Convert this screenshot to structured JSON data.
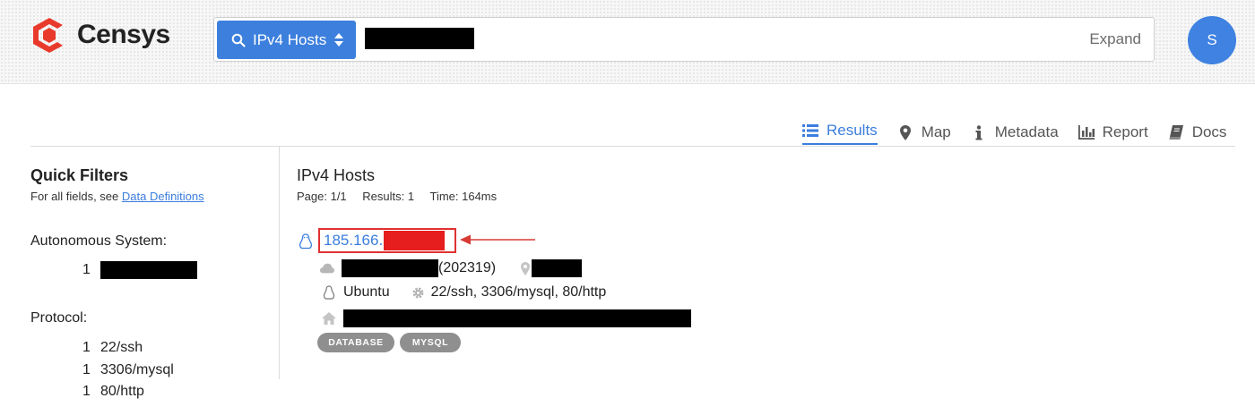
{
  "brand": {
    "name": "Censys"
  },
  "search": {
    "type_label": "IPv4 Hosts",
    "query_value": "",
    "expand_label": "Expand"
  },
  "user": {
    "avatar_initial": "S"
  },
  "tabs": [
    {
      "label": "Results",
      "icon": "list-icon",
      "active": true
    },
    {
      "label": "Map",
      "icon": "map-pin-icon",
      "active": false
    },
    {
      "label": "Metadata",
      "icon": "info-icon",
      "active": false
    },
    {
      "label": "Report",
      "icon": "bar-chart-icon",
      "active": false
    },
    {
      "label": "Docs",
      "icon": "book-icon",
      "active": false
    }
  ],
  "sidebar": {
    "title": "Quick Filters",
    "subtitle_prefix": "For all fields, see ",
    "subtitle_link": "Data Definitions",
    "facets": [
      {
        "title": "Autonomous System:",
        "items": [
          {
            "count": "1",
            "label": ""
          }
        ]
      },
      {
        "title": "Protocol:",
        "items": [
          {
            "count": "1",
            "label": "22/ssh"
          },
          {
            "count": "1",
            "label": "3306/mysql"
          },
          {
            "count": "1",
            "label": "80/http"
          }
        ]
      }
    ]
  },
  "main": {
    "title": "IPv4 Hosts",
    "page": "Page: 1/1",
    "results": "Results: 1",
    "time": "Time: 164ms",
    "result": {
      "ip_prefix": "185.166.",
      "asn": "(202319)",
      "os": "Ubuntu",
      "services": "22/ssh, 3306/mysql, 80/http",
      "tags": [
        "DATABASE",
        "MYSQL"
      ]
    }
  },
  "colors": {
    "accent": "#3b7ddd",
    "search_button": "#3c7fdd",
    "avatar": "#3f82e1",
    "logo_red": "#e8392b",
    "highlight_red": "#e03131",
    "tag_gray": "#8f8f8f"
  }
}
